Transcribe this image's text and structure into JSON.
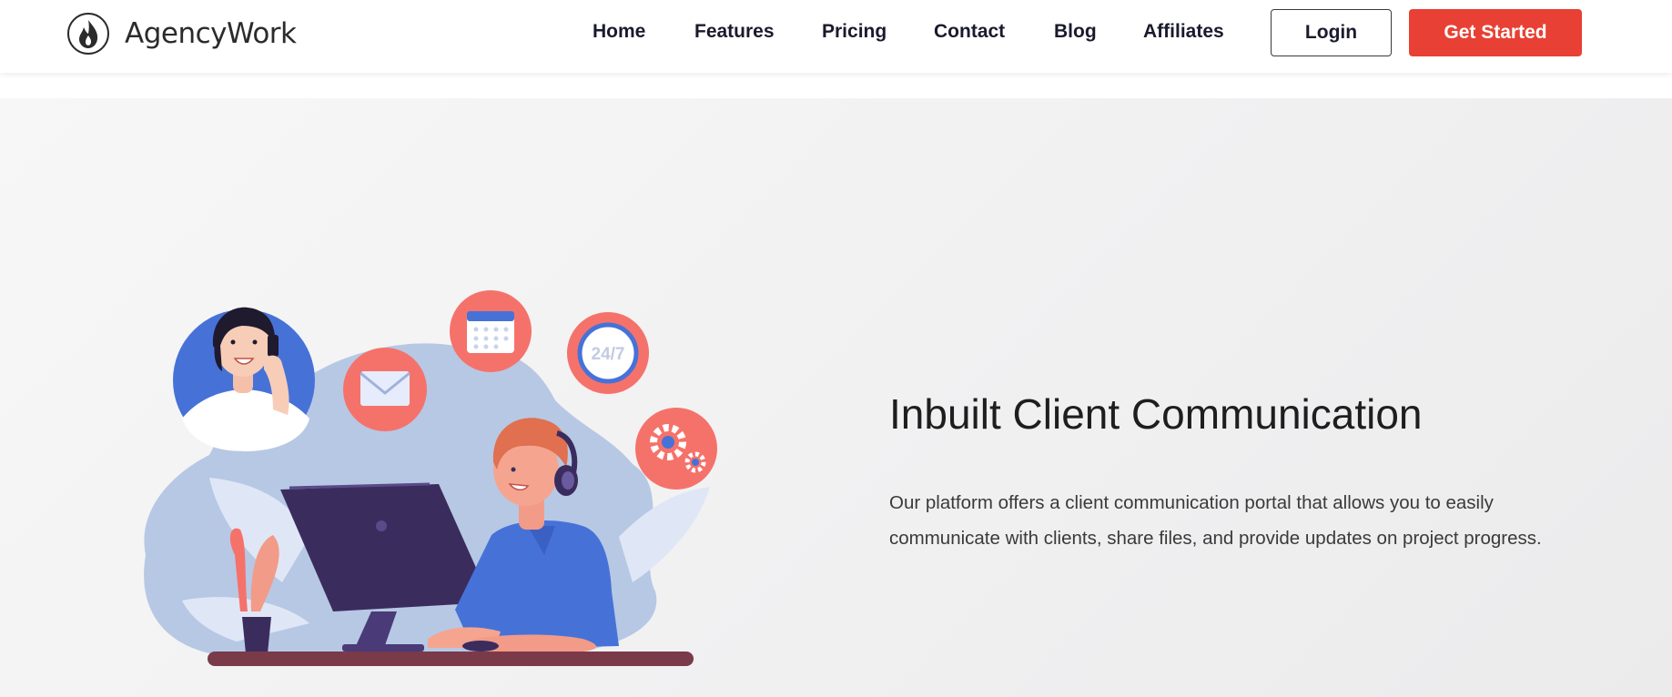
{
  "brand": {
    "name": "AgencyWork",
    "logo_icon": "flame-icon"
  },
  "nav": {
    "items": [
      {
        "label": "Home"
      },
      {
        "label": "Features"
      },
      {
        "label": "Pricing"
      },
      {
        "label": "Contact"
      },
      {
        "label": "Blog"
      },
      {
        "label": "Affiliates"
      }
    ],
    "login_label": "Login",
    "cta_label": "Get Started"
  },
  "hero": {
    "title": "Inbuilt Client Communication",
    "description": "Our platform offers a client communication portal that allows you to easily communicate with clients, share files, and provide updates on project progress.",
    "badge_24_7": "24/7",
    "illustration_icons": [
      "email-icon",
      "calendar-icon",
      "clock-icon",
      "gears-icon"
    ]
  },
  "colors": {
    "accent": "#e84034",
    "nav_text": "#1a1a2e",
    "bubble": "#f5726b",
    "blob": "#b7c8e4",
    "shirt": "#4672d8",
    "monitor": "#3b2c5e"
  }
}
